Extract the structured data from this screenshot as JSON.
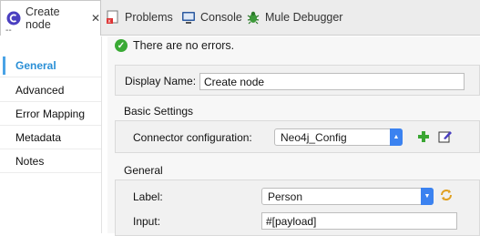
{
  "tabs": [
    {
      "label": "Create node"
    },
    {
      "label": "Problems"
    },
    {
      "label": "Console"
    },
    {
      "label": "Mule Debugger"
    }
  ],
  "tab_close": "✕",
  "tab_subtext": "--",
  "sidebar": {
    "items": [
      {
        "label": "General"
      },
      {
        "label": "Advanced"
      },
      {
        "label": "Error Mapping"
      },
      {
        "label": "Metadata"
      },
      {
        "label": "Notes"
      }
    ]
  },
  "status": {
    "text": "There are no errors.",
    "icon": "check-icon",
    "color": "#3aaa35"
  },
  "display_name": {
    "label": "Display Name:",
    "value": "Create node"
  },
  "basic_settings": {
    "title": "Basic Settings",
    "connector_label": "Connector configuration:",
    "connector_value": "Neo4j_Config"
  },
  "general": {
    "title": "General",
    "label_field": {
      "label": "Label:",
      "value": "Person"
    },
    "input_field": {
      "label": "Input:",
      "value": "#[payload]"
    }
  },
  "accent": "#2a8fd6"
}
